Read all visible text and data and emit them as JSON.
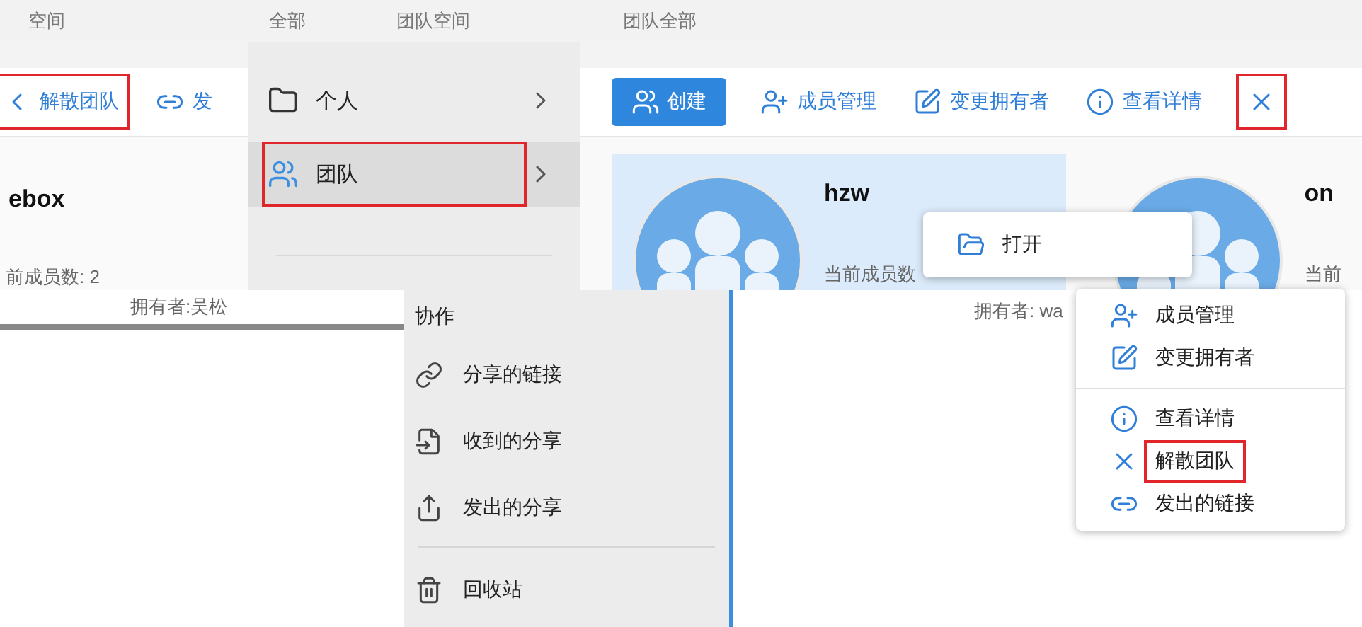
{
  "top_strip": {
    "labels": [
      "空间",
      "全部",
      "团队空间",
      "团队全部"
    ]
  },
  "left_fragment": {
    "toolbar": [
      {
        "label": "解散团队",
        "highlighted": true
      },
      {
        "label": "发",
        "highlighted": false
      }
    ],
    "card": {
      "name": "ebox",
      "members": "前成员数: 2",
      "owner": "拥有者:吴松"
    }
  },
  "nav_menu": {
    "items": [
      {
        "label": "个人",
        "selected": false,
        "highlighted": false
      },
      {
        "label": "团队",
        "selected": true,
        "highlighted": true
      }
    ]
  },
  "toolbar": {
    "create": "创建",
    "actions": [
      {
        "label": "成员管理",
        "highlighted": false
      },
      {
        "label": "变更拥有者",
        "highlighted": false
      },
      {
        "label": "查看详情",
        "highlighted": false
      },
      {
        "highlighted": true
      }
    ]
  },
  "cards": [
    {
      "name": "hzw",
      "members": "当前成员数",
      "owner": "拥有者: wa",
      "selected": true
    },
    {
      "name": "on",
      "members": "当前",
      "selected": false
    }
  ],
  "open_menu": {
    "items": [
      "打开"
    ]
  },
  "side_menu": {
    "header": "协作",
    "items": [
      "分享的链接",
      "收到的分享",
      "发出的分享"
    ],
    "trash": "回收站"
  },
  "context_menu": {
    "groups": [
      [
        {
          "label": "成员管理",
          "highlighted": false
        },
        {
          "label": "变更拥有者",
          "highlighted": false
        }
      ],
      [
        {
          "label": "查看详情",
          "highlighted": false
        },
        {
          "label": "解散团队",
          "highlighted": true
        },
        {
          "label": "发出的链接",
          "highlighted": false
        }
      ]
    ]
  }
}
